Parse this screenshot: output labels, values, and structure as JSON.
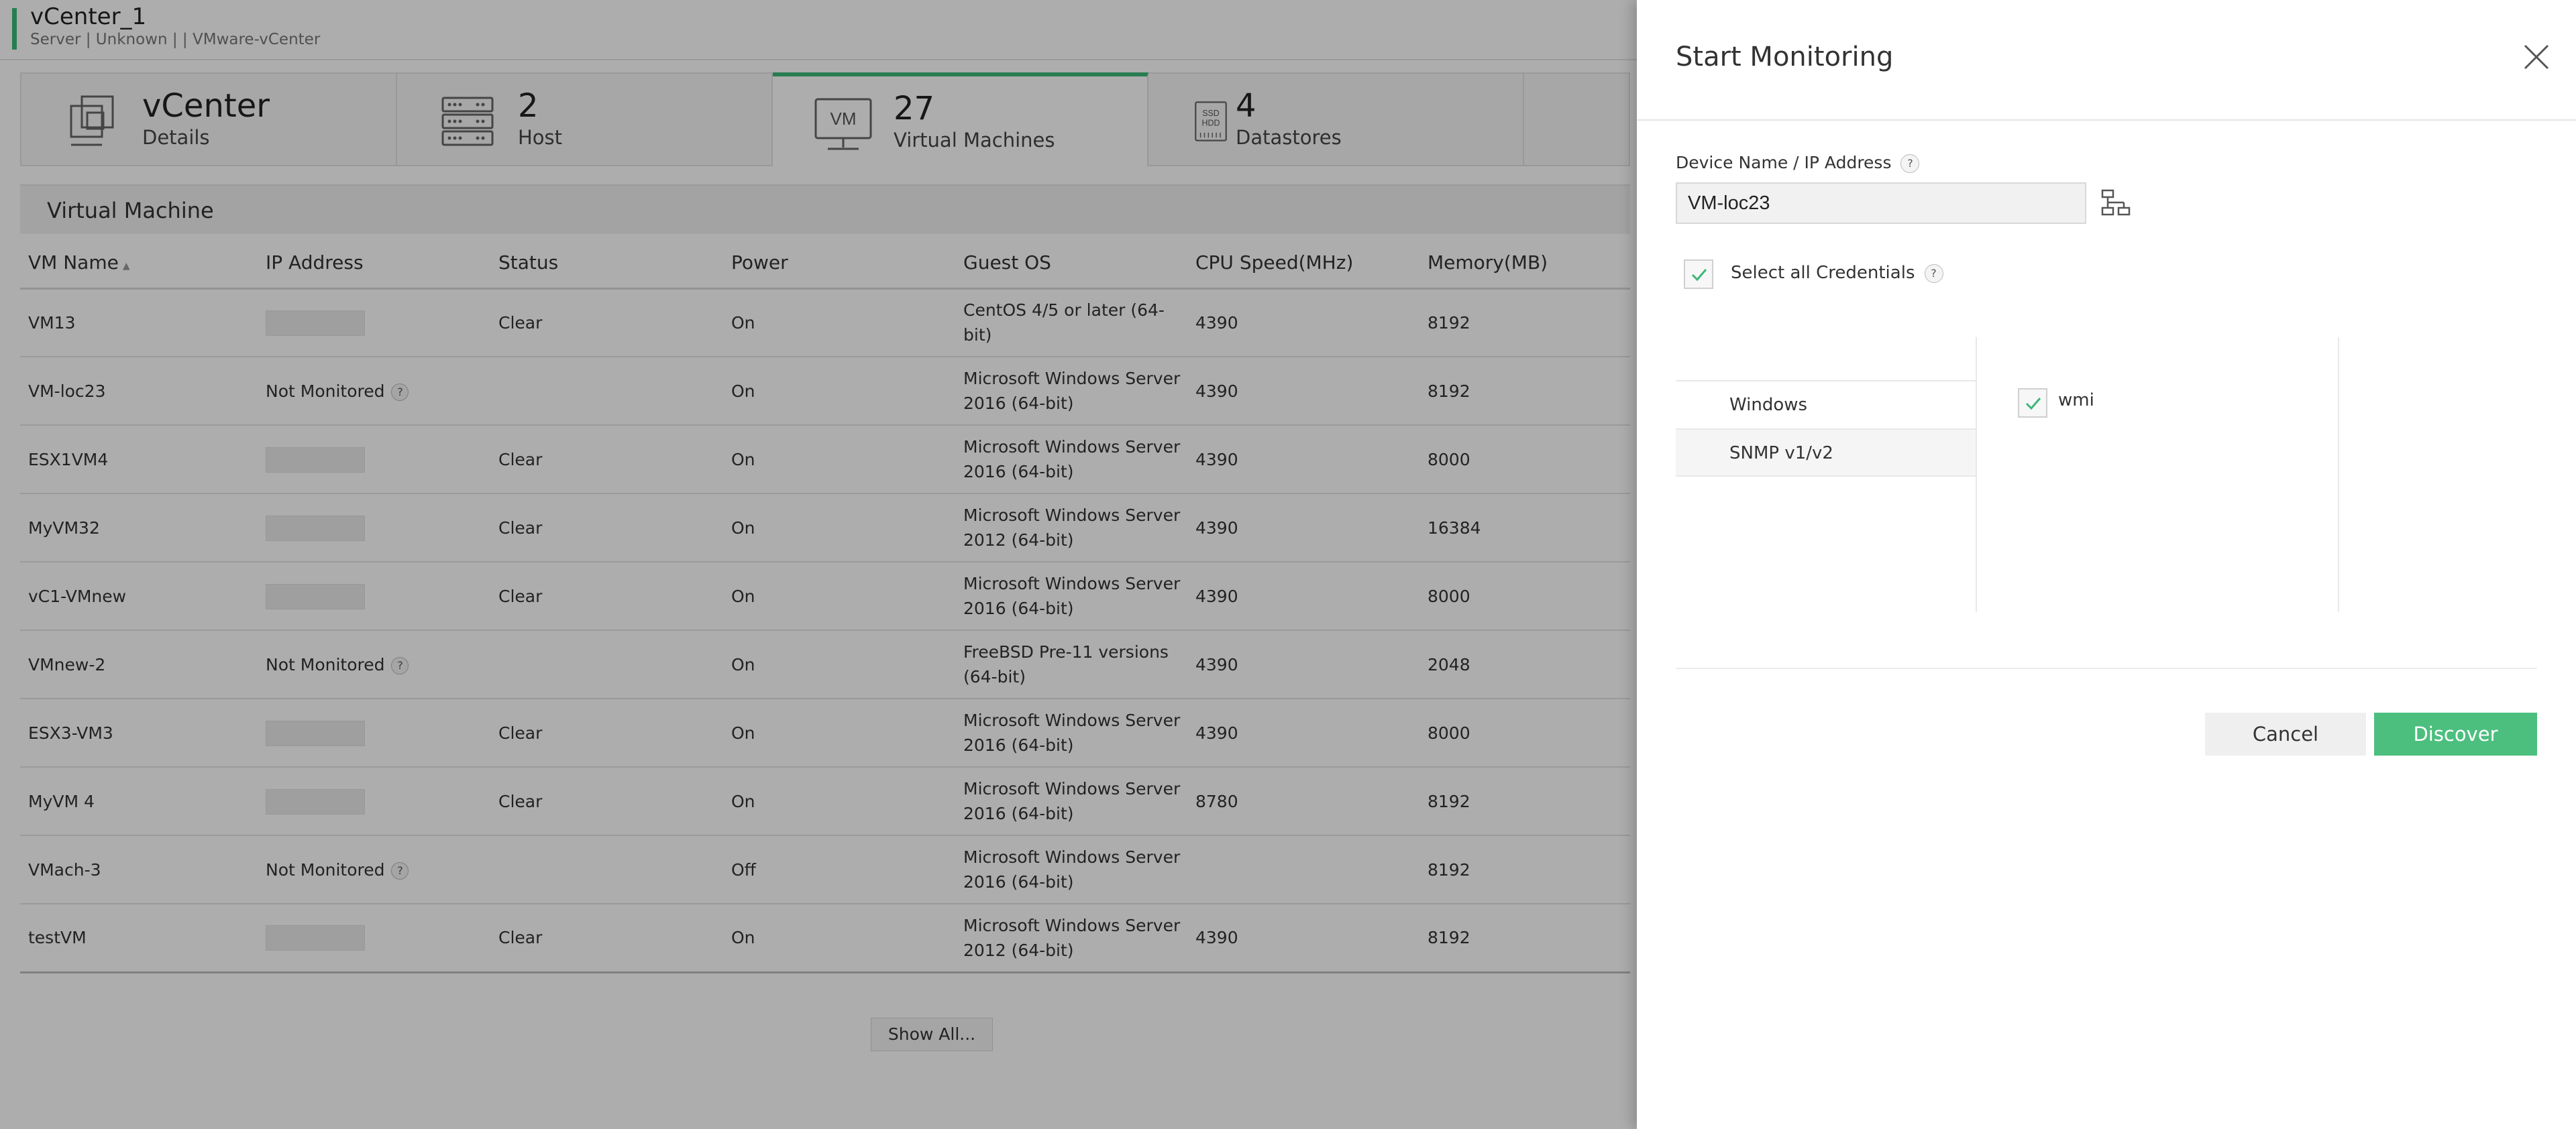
{
  "header": {
    "device_title": "vCenter_1",
    "device_meta": "Server | Unknown |   | VMware-vCenter"
  },
  "summary_cards": [
    {
      "number": "vCenter",
      "label": "Details",
      "icon": "vcenter-icon"
    },
    {
      "number": "2",
      "label": "Host",
      "icon": "host-icon"
    },
    {
      "number": "27",
      "label": "Virtual Machines",
      "icon": "vm-icon",
      "icon_text": "VM"
    },
    {
      "number": "4",
      "label": "Datastores",
      "icon": "datastore-icon",
      "icon_text_1": "SSD",
      "icon_text_2": "HDD"
    }
  ],
  "section": {
    "title": "Virtual Machine"
  },
  "table": {
    "columns": [
      "VM Name",
      "IP Address",
      "Status",
      "Power",
      "Guest OS",
      "CPU Speed(MHz)",
      "Memory(MB)"
    ],
    "rows": [
      {
        "name": "VM13",
        "ip": "",
        "status": "Clear",
        "power": "On",
        "os1": "CentOS 4/5 or later (64-bit)",
        "os2": "",
        "cpu": "4390",
        "mem": "8192"
      },
      {
        "name": "VM-loc23",
        "ip": "Not Monitored",
        "status": "",
        "power": "On",
        "os1": "Microsoft Windows Server",
        "os2": "2016 (64-bit)",
        "cpu": "4390",
        "mem": "8192"
      },
      {
        "name": "ESX1VM4",
        "ip": "",
        "status": "Clear",
        "power": "On",
        "os1": "Microsoft Windows Server",
        "os2": "2016 (64-bit)",
        "cpu": "4390",
        "mem": "8000"
      },
      {
        "name": "MyVM32",
        "ip": "",
        "status": "Clear",
        "power": "On",
        "os1": "Microsoft Windows Server",
        "os2": "2012 (64-bit)",
        "cpu": "4390",
        "mem": "16384"
      },
      {
        "name": "vC1-VMnew",
        "ip": "",
        "status": "Clear",
        "power": "On",
        "os1": "Microsoft Windows Server",
        "os2": "2016 (64-bit)",
        "cpu": "4390",
        "mem": "8000"
      },
      {
        "name": "VMnew-2",
        "ip": "Not Monitored",
        "status": "",
        "power": "On",
        "os1": "FreeBSD Pre-11 versions",
        "os2": "(64-bit)",
        "cpu": "4390",
        "mem": "2048"
      },
      {
        "name": "ESX3-VM3",
        "ip": "",
        "status": "Clear",
        "power": "On",
        "os1": "Microsoft Windows Server",
        "os2": "2016 (64-bit)",
        "cpu": "4390",
        "mem": "8000"
      },
      {
        "name": "MyVM 4",
        "ip": "",
        "status": "Clear",
        "power": "On",
        "os1": "Microsoft Windows Server",
        "os2": "2016 (64-bit)",
        "cpu": "8780",
        "mem": "8192"
      },
      {
        "name": "VMach-3",
        "ip": "Not Monitored",
        "status": "",
        "power": "Off",
        "os1": "Microsoft Windows Server",
        "os2": "2016 (64-bit)",
        "cpu": "",
        "mem": "8192"
      },
      {
        "name": "testVM",
        "ip": "",
        "status": "Clear",
        "power": "On",
        "os1": "Microsoft Windows Server",
        "os2": "2012 (64-bit)",
        "cpu": "4390",
        "mem": "8192"
      }
    ],
    "help_glyph": "?",
    "show_all_label": "Show All..."
  },
  "panel": {
    "title": "Start Monitoring",
    "device_label": "Device Name / IP Address",
    "device_value": "VM-loc23",
    "help_glyph": "?",
    "select_all_label": "Select all Credentials",
    "credential_types": [
      "Windows",
      "SNMP v1/v2"
    ],
    "selected_credential": "wmi",
    "cancel_label": "Cancel",
    "discover_label": "Discover"
  },
  "colors": {
    "accent_green": "#3cb878",
    "discover_button": "#4cbf7f"
  }
}
